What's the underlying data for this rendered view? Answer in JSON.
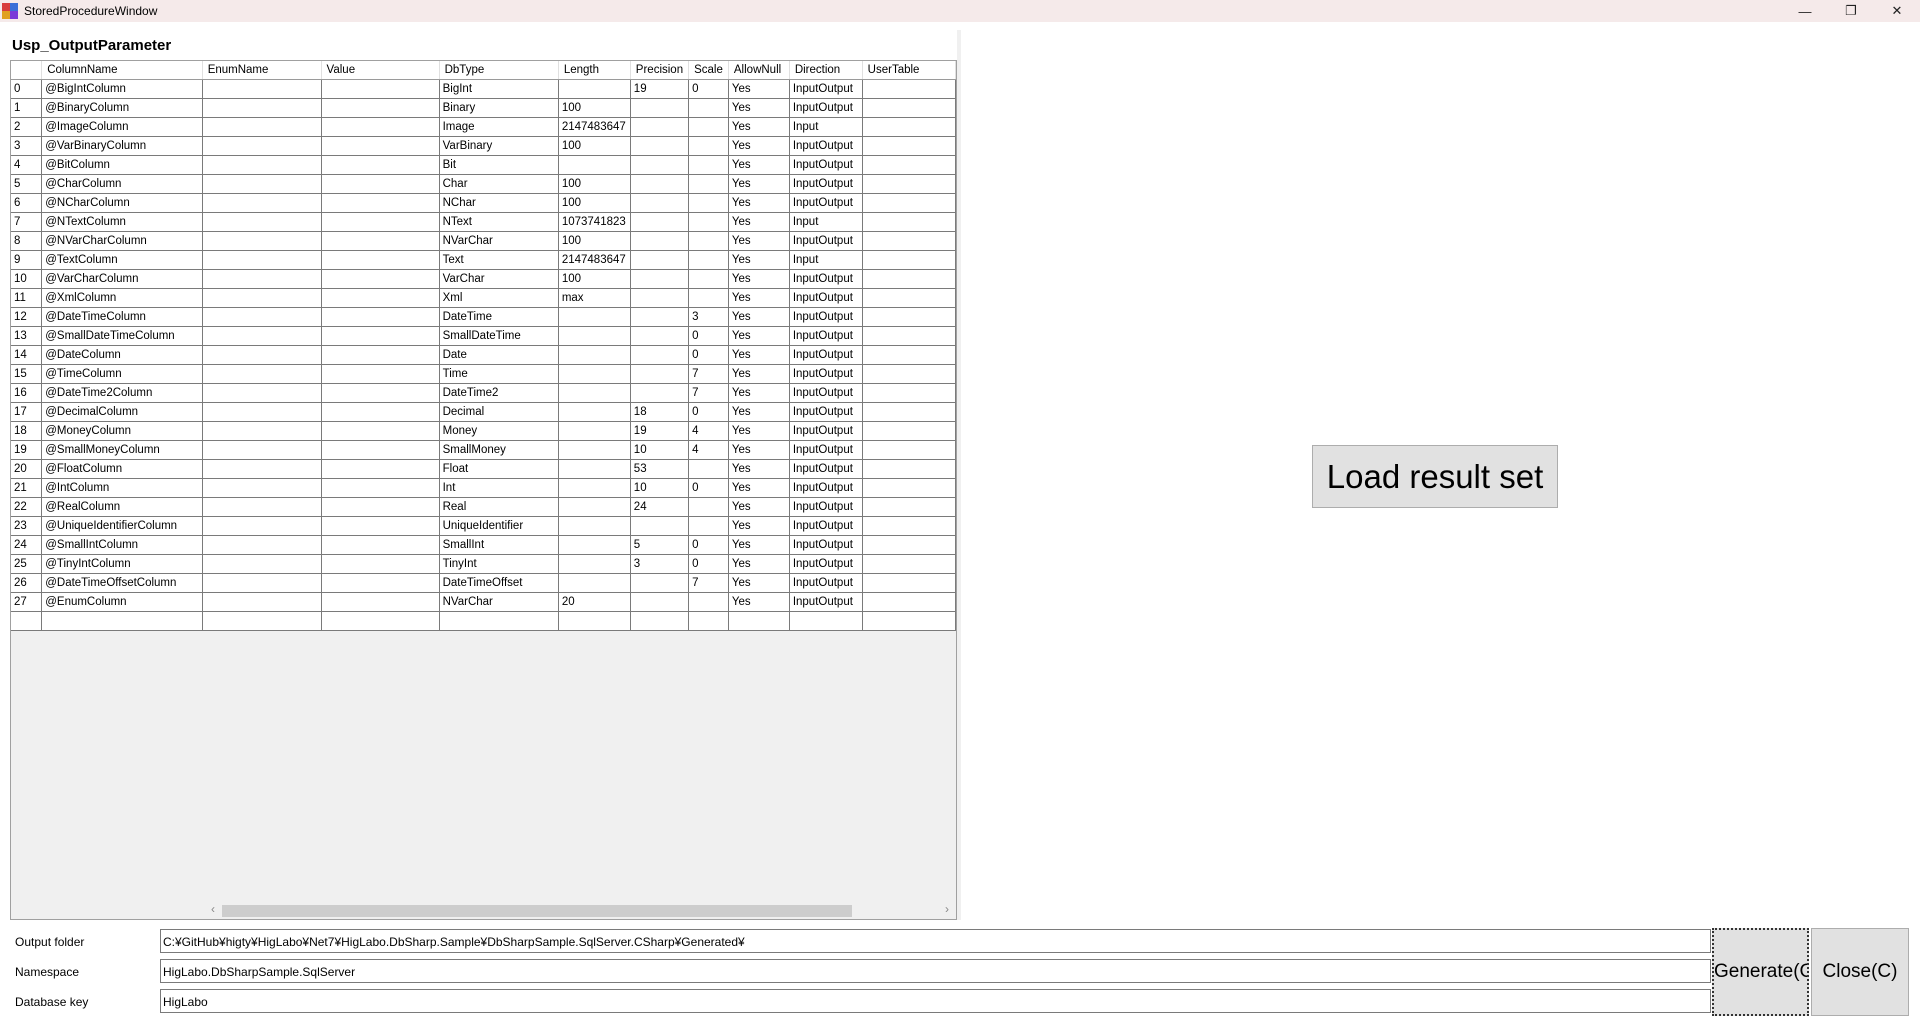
{
  "window": {
    "title": "StoredProcedureWindow",
    "minimize": "—",
    "restore": "❐",
    "close": "✕"
  },
  "procedure_name": "Usp_OutputParameter",
  "columns": [
    "",
    "ColumnName",
    "EnumName",
    "Value",
    "DbType",
    "Length",
    "Precision",
    "Scale",
    "AllowNull",
    "Direction",
    "UserTable"
  ],
  "rows": [
    [
      "0",
      "@BigIntColumn",
      "",
      "",
      "BigInt",
      "",
      "19",
      "0",
      "Yes",
      "InputOutput",
      ""
    ],
    [
      "1",
      "@BinaryColumn",
      "",
      "",
      "Binary",
      "100",
      "",
      "",
      "Yes",
      "InputOutput",
      ""
    ],
    [
      "2",
      "@ImageColumn",
      "",
      "",
      "Image",
      "2147483647",
      "",
      "",
      "Yes",
      "Input",
      ""
    ],
    [
      "3",
      "@VarBinaryColumn",
      "",
      "",
      "VarBinary",
      "100",
      "",
      "",
      "Yes",
      "InputOutput",
      ""
    ],
    [
      "4",
      "@BitColumn",
      "",
      "",
      "Bit",
      "",
      "",
      "",
      "Yes",
      "InputOutput",
      ""
    ],
    [
      "5",
      "@CharColumn",
      "",
      "",
      "Char",
      "100",
      "",
      "",
      "Yes",
      "InputOutput",
      ""
    ],
    [
      "6",
      "@NCharColumn",
      "",
      "",
      "NChar",
      "100",
      "",
      "",
      "Yes",
      "InputOutput",
      ""
    ],
    [
      "7",
      "@NTextColumn",
      "",
      "",
      "NText",
      "1073741823",
      "",
      "",
      "Yes",
      "Input",
      ""
    ],
    [
      "8",
      "@NVarCharColumn",
      "",
      "",
      "NVarChar",
      "100",
      "",
      "",
      "Yes",
      "InputOutput",
      ""
    ],
    [
      "9",
      "@TextColumn",
      "",
      "",
      "Text",
      "2147483647",
      "",
      "",
      "Yes",
      "Input",
      ""
    ],
    [
      "10",
      "@VarCharColumn",
      "",
      "",
      "VarChar",
      "100",
      "",
      "",
      "Yes",
      "InputOutput",
      ""
    ],
    [
      "11",
      "@XmlColumn",
      "",
      "",
      "Xml",
      "max",
      "",
      "",
      "Yes",
      "InputOutput",
      ""
    ],
    [
      "12",
      "@DateTimeColumn",
      "",
      "",
      "DateTime",
      "",
      "",
      "3",
      "Yes",
      "InputOutput",
      ""
    ],
    [
      "13",
      "@SmallDateTimeColumn",
      "",
      "",
      "SmallDateTime",
      "",
      "",
      "0",
      "Yes",
      "InputOutput",
      ""
    ],
    [
      "14",
      "@DateColumn",
      "",
      "",
      "Date",
      "",
      "",
      "0",
      "Yes",
      "InputOutput",
      ""
    ],
    [
      "15",
      "@TimeColumn",
      "",
      "",
      "Time",
      "",
      "",
      "7",
      "Yes",
      "InputOutput",
      ""
    ],
    [
      "16",
      "@DateTime2Column",
      "",
      "",
      "DateTime2",
      "",
      "",
      "7",
      "Yes",
      "InputOutput",
      ""
    ],
    [
      "17",
      "@DecimalColumn",
      "",
      "",
      "Decimal",
      "",
      "18",
      "0",
      "Yes",
      "InputOutput",
      ""
    ],
    [
      "18",
      "@MoneyColumn",
      "",
      "",
      "Money",
      "",
      "19",
      "4",
      "Yes",
      "InputOutput",
      ""
    ],
    [
      "19",
      "@SmallMoneyColumn",
      "",
      "",
      "SmallMoney",
      "",
      "10",
      "4",
      "Yes",
      "InputOutput",
      ""
    ],
    [
      "20",
      "@FloatColumn",
      "",
      "",
      "Float",
      "",
      "53",
      "",
      "Yes",
      "InputOutput",
      ""
    ],
    [
      "21",
      "@IntColumn",
      "",
      "",
      "Int",
      "",
      "10",
      "0",
      "Yes",
      "InputOutput",
      ""
    ],
    [
      "22",
      "@RealColumn",
      "",
      "",
      "Real",
      "",
      "24",
      "",
      "Yes",
      "InputOutput",
      ""
    ],
    [
      "23",
      "@UniqueIdentifierColumn",
      "",
      "",
      "UniqueIdentifier",
      "",
      "",
      "",
      "Yes",
      "InputOutput",
      ""
    ],
    [
      "24",
      "@SmallIntColumn",
      "",
      "",
      "SmallInt",
      "",
      "5",
      "0",
      "Yes",
      "InputOutput",
      ""
    ],
    [
      "25",
      "@TinyIntColumn",
      "",
      "",
      "TinyInt",
      "",
      "3",
      "0",
      "Yes",
      "InputOutput",
      ""
    ],
    [
      "26",
      "@DateTimeOffsetColumn",
      "",
      "",
      "DateTimeOffset",
      "",
      "",
      "7",
      "Yes",
      "InputOutput",
      ""
    ],
    [
      "27",
      "@EnumColumn",
      "",
      "",
      "NVarChar",
      "20",
      "",
      "",
      "Yes",
      "InputOutput",
      ""
    ],
    [
      "",
      "",
      "",
      "",
      "",
      "",
      "",
      "",
      "",
      "",
      ""
    ]
  ],
  "scroll": {
    "left_arrow": "‹",
    "right_arrow": "›"
  },
  "load_button": "Load result set",
  "form": {
    "output_folder_label": "Output folder",
    "output_folder_value": "C:¥GitHub¥higty¥HigLabo¥Net7¥HigLabo.DbSharp.Sample¥DbSharpSample.SqlServer.CSharp¥Generated¥",
    "namespace_label": "Namespace",
    "namespace_value": "HigLabo.DbSharpSample.SqlServer",
    "database_key_label": "Database key",
    "database_key_value": "HigLabo"
  },
  "buttons": {
    "generate": "Generate(G",
    "close": "Close(C)"
  },
  "colors": {
    "titlebar": "#f5eaea",
    "button_face": "#e1e1e1",
    "panel": "#f0f0f0"
  }
}
